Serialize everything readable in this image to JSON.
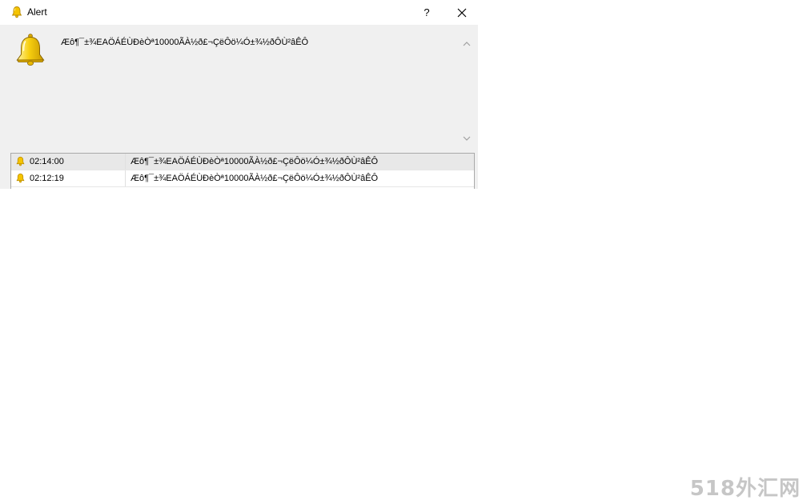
{
  "window": {
    "title": "Alert",
    "help_label": "?",
    "close_label": "✕",
    "icon": "bell-icon"
  },
  "alert": {
    "icon": "bell-icon",
    "message": "Æô¶¯±¾EAÖÁÉÙÐèÒª10000ÃÀ½ð£¬ÇëÔö¼Ó±¾½ðÔÙ²âÊÔ"
  },
  "history": {
    "rows": [
      {
        "time": "02:14:00",
        "message": "Æô¶¯±¾EAÖÁÉÙÐèÒª10000ÃÀ½ð£¬ÇëÔö¼Ó±¾½ðÔÙ²âÊÔ",
        "selected": true
      },
      {
        "time": "02:12:19",
        "message": "Æô¶¯±¾EAÖÁÉÙÐèÒª10000ÃÀ½ð£¬ÇëÔö¼Ó±¾½ðÔÙ²âÊÔ",
        "selected": false
      }
    ]
  },
  "watermark": {
    "text": "518外汇网"
  },
  "colors": {
    "bell": "#f5c400",
    "bell_outline": "#b88a00",
    "dialog_bg": "#f0f0f0",
    "selected_row": "#e8e8e8"
  }
}
